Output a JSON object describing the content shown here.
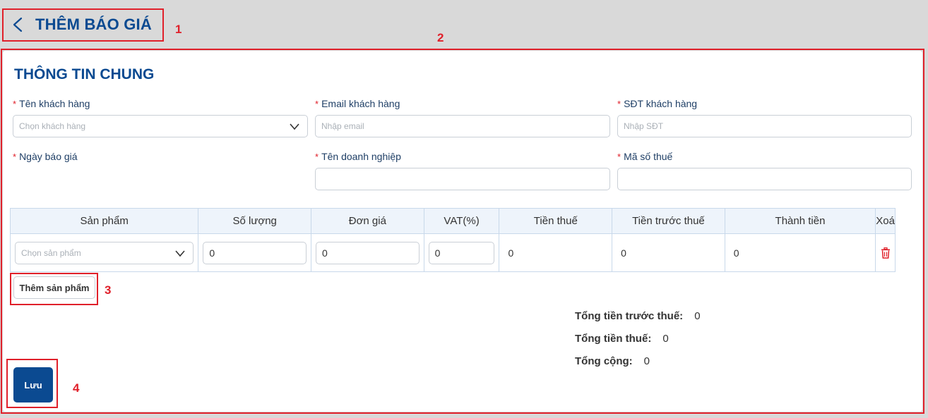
{
  "header": {
    "title": "THÊM BÁO GIÁ"
  },
  "section": {
    "title": "THÔNG TIN CHUNG"
  },
  "fields": {
    "customer_name": {
      "label": "Tên khách hàng",
      "placeholder": "Chọn khách hàng"
    },
    "customer_email": {
      "label": "Email khách hàng",
      "placeholder": "Nhập email"
    },
    "customer_phone": {
      "label": "SĐT khách hàng",
      "placeholder": "Nhập SĐT"
    },
    "quote_date": {
      "label": "Ngày báo giá"
    },
    "company_name": {
      "label": "Tên doanh nghiệp",
      "placeholder": ""
    },
    "tax_code": {
      "label": "Mã số thuế",
      "placeholder": ""
    }
  },
  "required_marker": "*",
  "table": {
    "headers": [
      "Sản phẩm",
      "Số lượng",
      "Đơn giá",
      "VAT(%)",
      "Tiền thuế",
      "Tiền trước thuế",
      "Thành tiền",
      "Xoá"
    ],
    "row": {
      "product_placeholder": "Chọn sản phẩm",
      "quantity": "0",
      "unit_price": "0",
      "vat": "0",
      "tax_amount": "0",
      "pre_tax": "0",
      "total": "0"
    }
  },
  "add_product_label": "Thêm sản phẩm",
  "totals": {
    "pre_tax_label": "Tổng tiền trước thuế:",
    "pre_tax_value": "0",
    "tax_label": "Tổng tiền thuế:",
    "tax_value": "0",
    "grand_label": "Tổng cộng:",
    "grand_value": "0"
  },
  "save_label": "Lưu",
  "annotations": [
    "1",
    "2",
    "3",
    "4"
  ],
  "colors": {
    "primary": "#0b4a91",
    "annotation": "#e0202a",
    "required": "#e0202a"
  }
}
